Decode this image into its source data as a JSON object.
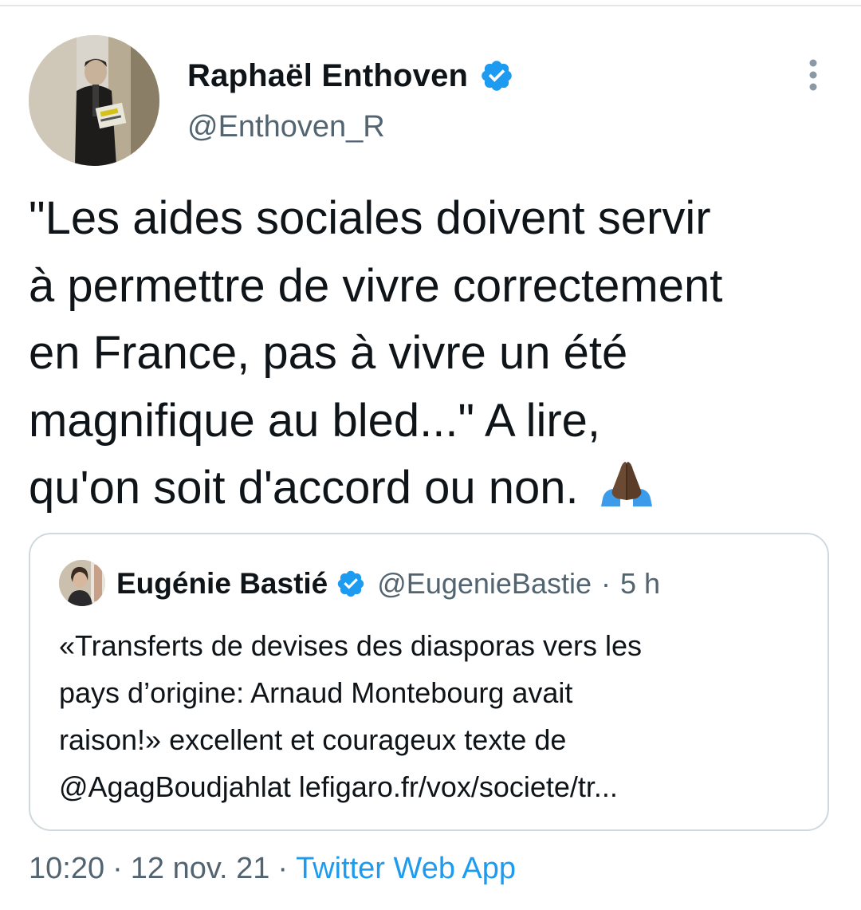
{
  "author": {
    "name": "Raphaël Enthoven",
    "handle": "@Enthoven_R",
    "verified": true,
    "avatar": "profile-photo"
  },
  "tweet": {
    "lines": [
      "\"Les aides sociales doivent servir",
      "à permettre de vivre correctement",
      "en France, pas à vivre un été",
      "magnifique au bled...\" A lire,",
      "qu'on soit d'accord ou non."
    ],
    "emoji": "folded-hands-emoji"
  },
  "quoted_tweet": {
    "name": "Eugénie Bastié",
    "handle": "@EugenieBastie",
    "separator": "·",
    "time": "5 h",
    "verified": true,
    "lines": [
      "«Transferts de devises des diasporas vers les",
      "pays d’origine: Arnaud Montebourg avait",
      "raison!» excellent et courageux texte de",
      "@AgagBoudjahlat  lefigaro.fr/vox/societe/tr..."
    ]
  },
  "meta": {
    "time": "10:20",
    "separator": "·",
    "date": "12 nov. 21",
    "source": "Twitter Web App"
  },
  "colors": {
    "text": "#0f1419",
    "secondary": "#536471",
    "accent": "#1d9bf0",
    "border": "#cfd9de"
  },
  "icons": {
    "verified": "verified-badge-icon",
    "more": "more-vertical-icon"
  }
}
